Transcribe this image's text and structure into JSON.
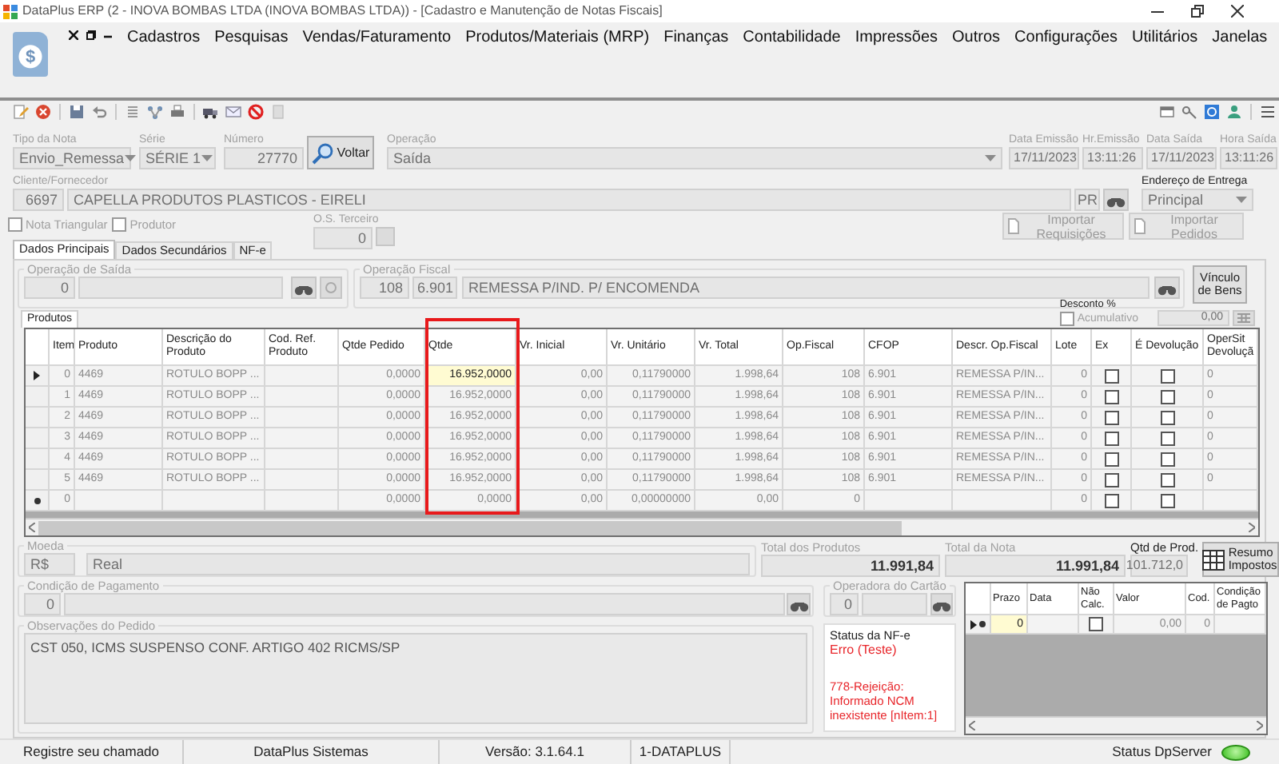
{
  "window": {
    "title": "DataPlus ERP (2 - INOVA BOMBAS LTDA  (INOVA BOMBAS LTDA)) - [Cadastro e Manutenção de Notas Fiscais]"
  },
  "app_logo": {
    "symbol": "$"
  },
  "menu": [
    "Cadastros",
    "Pesquisas",
    "Vendas/Faturamento",
    "Produtos/Materiais (MRP)",
    "Finanças",
    "Contabilidade",
    "Impressões",
    "Outros",
    "Configurações",
    "Utilitários",
    "Janelas"
  ],
  "header": {
    "tipo_da_nota": {
      "label": "Tipo da Nota",
      "value": "Envio_Remessa"
    },
    "serie": {
      "label": "Série",
      "value": "SÉRIE 1"
    },
    "numero": {
      "label": "Número",
      "value": "27770"
    },
    "voltar_button": "Voltar",
    "operacao": {
      "label": "Operação",
      "value": "Saída"
    },
    "data_emissao": {
      "label": "Data Emissão",
      "value": "17/11/2023"
    },
    "hr_emissao": {
      "label": "Hr.Emissão",
      "value": "13:11:26"
    },
    "data_saida": {
      "label": "Data Saída",
      "value": "17/11/2023"
    },
    "hora_saida": {
      "label": "Hora Saída",
      "value": "13:11:26"
    }
  },
  "cliente": {
    "label": "Cliente/Fornecedor",
    "code": "6697",
    "name": "CAPELLA PRODUTOS PLASTICOS - EIRELI",
    "uf": "PR"
  },
  "endereco_entrega": {
    "label": "Endereço de Entrega",
    "value": "Principal"
  },
  "options": [
    {
      "label": "Nota Triangular",
      "checked": false
    },
    {
      "label": "Produtor",
      "checked": false
    }
  ],
  "os_terceiro": {
    "label": "O.S. Terceiro",
    "value": "0"
  },
  "import_buttons": [
    "Importar Requisições",
    "Importar Pedidos"
  ],
  "tabs": [
    {
      "label": "Dados Principais",
      "selected": true
    },
    {
      "label": "Dados Secundários",
      "selected": false
    },
    {
      "label": "NF-e",
      "selected": false
    }
  ],
  "operacao_saida": {
    "label": "Operação de Saída",
    "code": "0"
  },
  "operacao_fiscal": {
    "label": "Operação Fiscal",
    "code": "108",
    "cfop": "6.901",
    "name": "REMESSA P/IND. P/ ENCOMENDA"
  },
  "vinculo_button": "Vínculo de Bens",
  "products_tab": "Produtos",
  "desconto": {
    "label": "Desconto %",
    "acumulativo": {
      "label": "Acumulativo",
      "checked": false
    },
    "value": "0,00"
  },
  "grid": {
    "columns": [
      {
        "label": "Item",
        "current": false,
        "highlighted": false
      },
      {
        "label": "Produto",
        "current": false,
        "highlighted": false
      },
      {
        "label": "Descrição do Produto",
        "current": false,
        "highlighted": false
      },
      {
        "label": "Cod. Ref. Produto",
        "current": false,
        "highlighted": false
      },
      {
        "label": "Qtde Pedido",
        "current": false,
        "highlighted": false
      },
      {
        "label": "Qtde",
        "current": true,
        "highlighted": true
      },
      {
        "label": "Vr. Inicial",
        "current": false,
        "highlighted": false
      },
      {
        "label": "Vr. Unitário",
        "current": false,
        "highlighted": false
      },
      {
        "label": "Vr. Total",
        "current": false,
        "highlighted": false
      },
      {
        "label": "Op.Fiscal",
        "current": false,
        "highlighted": false
      },
      {
        "label": "CFOP",
        "current": false,
        "highlighted": false
      },
      {
        "label": "Descr. Op.Fiscal",
        "current": false,
        "highlighted": false
      },
      {
        "label": "Lote",
        "current": false,
        "highlighted": false
      },
      {
        "label": "Ex",
        "current": false,
        "highlighted": false
      },
      {
        "label": "É Devolução",
        "current": false,
        "highlighted": false
      },
      {
        "label": "OperSit Devoluçã",
        "current": false,
        "highlighted": false
      }
    ],
    "rows": [
      {
        "selected": true,
        "new": false,
        "item": "0",
        "produto": "4469",
        "descricao": "ROTULO BOPP ...",
        "qtde_pedido": "0,0000",
        "qtde": "16.952,0000",
        "vr_inicial": "0,00",
        "vr_unitario": "0,11790000",
        "vr_total": "1.998,64",
        "op_fiscal": "108",
        "cfop": "6.901",
        "descr_op_fiscal": "REMESSA P/IN...",
        "lote": "0",
        "ex": false,
        "devolucao": false,
        "opersit_devolucao": "0"
      },
      {
        "selected": false,
        "new": false,
        "item": "1",
        "produto": "4469",
        "descricao": "ROTULO BOPP ...",
        "qtde_pedido": "0,0000",
        "qtde": "16.952,0000",
        "vr_inicial": "0,00",
        "vr_unitario": "0,11790000",
        "vr_total": "1.998,64",
        "op_fiscal": "108",
        "cfop": "6.901",
        "descr_op_fiscal": "REMESSA P/IN...",
        "lote": "0",
        "ex": false,
        "devolucao": false,
        "opersit_devolucao": "0"
      },
      {
        "selected": false,
        "new": false,
        "item": "2",
        "produto": "4469",
        "descricao": "ROTULO BOPP ...",
        "qtde_pedido": "0,0000",
        "qtde": "16.952,0000",
        "vr_inicial": "0,00",
        "vr_unitario": "0,11790000",
        "vr_total": "1.998,64",
        "op_fiscal": "108",
        "cfop": "6.901",
        "descr_op_fiscal": "REMESSA P/IN...",
        "lote": "0",
        "ex": false,
        "devolucao": false,
        "opersit_devolucao": "0"
      },
      {
        "selected": false,
        "new": false,
        "item": "3",
        "produto": "4469",
        "descricao": "ROTULO BOPP ...",
        "qtde_pedido": "0,0000",
        "qtde": "16.952,0000",
        "vr_inicial": "0,00",
        "vr_unitario": "0,11790000",
        "vr_total": "1.998,64",
        "op_fiscal": "108",
        "cfop": "6.901",
        "descr_op_fiscal": "REMESSA P/IN...",
        "lote": "0",
        "ex": false,
        "devolucao": false,
        "opersit_devolucao": "0"
      },
      {
        "selected": false,
        "new": false,
        "item": "4",
        "produto": "4469",
        "descricao": "ROTULO BOPP ...",
        "qtde_pedido": "0,0000",
        "qtde": "16.952,0000",
        "vr_inicial": "0,00",
        "vr_unitario": "0,11790000",
        "vr_total": "1.998,64",
        "op_fiscal": "108",
        "cfop": "6.901",
        "descr_op_fiscal": "REMESSA P/IN...",
        "lote": "0",
        "ex": false,
        "devolucao": false,
        "opersit_devolucao": "0"
      },
      {
        "selected": false,
        "new": false,
        "item": "5",
        "produto": "4469",
        "descricao": "ROTULO BOPP ...",
        "qtde_pedido": "0,0000",
        "qtde": "16.952,0000",
        "vr_inicial": "0,00",
        "vr_unitario": "0,11790000",
        "vr_total": "1.998,64",
        "op_fiscal": "108",
        "cfop": "6.901",
        "descr_op_fiscal": "REMESSA P/IN...",
        "lote": "0",
        "ex": false,
        "devolucao": false,
        "opersit_devolucao": "0"
      },
      {
        "selected": false,
        "new": true,
        "item": "0",
        "qtde_pedido": "0,0000",
        "qtde": "0,0000",
        "vr_inicial": "0,00",
        "vr_unitario": "0,00000000",
        "vr_total": "0,00",
        "op_fiscal": "0",
        "lote": "0",
        "ex": false,
        "devolucao": false
      }
    ]
  },
  "moeda": {
    "label": "Moeda",
    "code": "R$",
    "name": "Real"
  },
  "total_produtos": {
    "label": "Total dos Produtos",
    "value": "11.991,84"
  },
  "total_nota": {
    "label": "Total da Nota",
    "value": "11.991,84"
  },
  "qtd_produtos": {
    "label": "Qtd de Prod.",
    "value": "101.712,0"
  },
  "resumo_button": "Resumo Impostos",
  "condicao_pagamento": {
    "label": "Condição de Pagamento",
    "code": "0"
  },
  "operadora_cartao": {
    "label": "Operadora do Cartão",
    "code": "0"
  },
  "observacoes": {
    "label": "Observações do Pedido",
    "text": "CST 050, ICMS SUSPENSO CONF. ARTIGO 402 RICMS/SP"
  },
  "status_nfe": {
    "label": "Status da NF-e",
    "status": "Erro (Teste)",
    "message": "778-Rejeição: Informado NCM inexistente [nItem:1]"
  },
  "payments": {
    "columns": [
      {
        "label": "Prazo",
        "current": true
      },
      {
        "label": "Data",
        "current": false
      },
      {
        "label": "Não Calc.",
        "current": false
      },
      {
        "label": "Valor",
        "current": false
      },
      {
        "label": "Cod.",
        "current": false
      },
      {
        "label": "Condição de Pagto",
        "current": false
      }
    ],
    "rows": [
      {
        "selected": true,
        "new": true,
        "prazo": "0",
        "nao_calc": false,
        "valor": "0,00",
        "cod": "0"
      }
    ]
  },
  "status_bar": {
    "items": [
      "Registre seu chamado",
      "DataPlus Sistemas",
      "Versão: 3.1.64.1",
      "1-DATAPLUS"
    ],
    "server": {
      "label": "Status DpServer",
      "online": true
    }
  }
}
